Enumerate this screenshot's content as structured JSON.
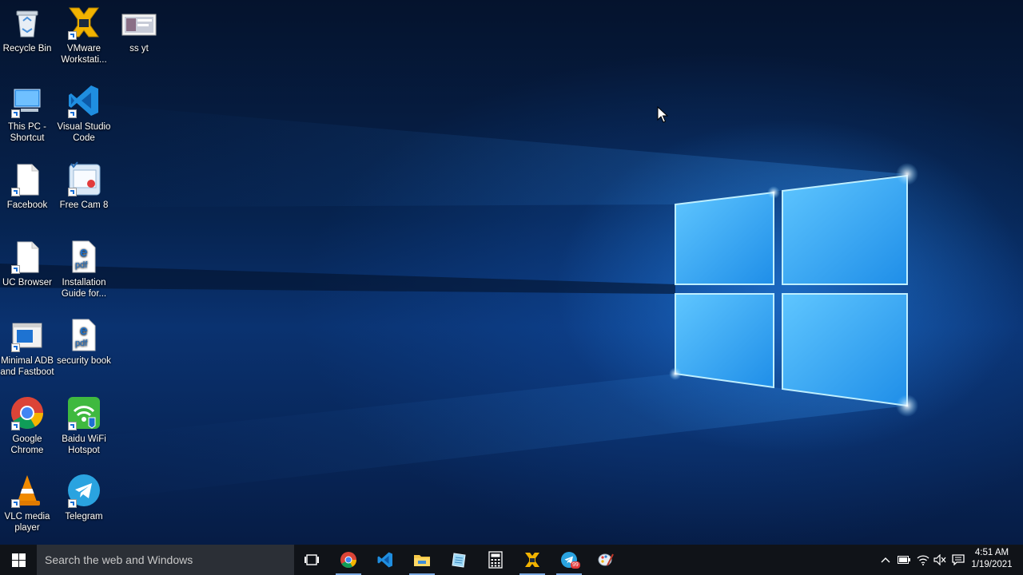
{
  "desktop": {
    "icons": [
      {
        "label": "Recycle Bin",
        "icon": "recycle-bin-icon"
      },
      {
        "label": "VMware Workstati...",
        "icon": "vmware-icon"
      },
      {
        "label": "ss yt",
        "icon": "image-thumbnail-icon"
      },
      {
        "label": "This PC - Shortcut",
        "icon": "this-pc-icon"
      },
      {
        "label": "Visual Studio Code",
        "icon": "vscode-icon"
      },
      {
        "label": "Facebook",
        "icon": "file-icon"
      },
      {
        "label": "Free Cam 8",
        "icon": "free-cam-icon"
      },
      {
        "label": "UC Browser",
        "icon": "file-icon"
      },
      {
        "label": "Installation Guide for...",
        "icon": "edge-pdf-icon"
      },
      {
        "label": "Minimal ADB and Fastboot",
        "icon": "window-app-icon"
      },
      {
        "label": "security book",
        "icon": "edge-pdf-icon"
      },
      {
        "label": "Google Chrome",
        "icon": "chrome-icon"
      },
      {
        "label": "Baidu WiFi Hotspot",
        "icon": "baidu-wifi-icon"
      },
      {
        "label": "VLC media player",
        "icon": "vlc-icon"
      },
      {
        "label": "Telegram",
        "icon": "telegram-icon"
      }
    ]
  },
  "taskbar": {
    "search_placeholder": "Search the web and Windows",
    "pinned": [
      {
        "name": "task-view",
        "icon": "task-view-icon"
      },
      {
        "name": "google-chrome",
        "icon": "chrome-icon"
      },
      {
        "name": "visual-studio-code",
        "icon": "vscode-icon"
      },
      {
        "name": "file-explorer",
        "icon": "folder-icon"
      },
      {
        "name": "notepad",
        "icon": "notepad-icon"
      },
      {
        "name": "calculator",
        "icon": "calculator-icon"
      },
      {
        "name": "vmware",
        "icon": "vmware-icon"
      },
      {
        "name": "telegram",
        "icon": "telegram-icon"
      },
      {
        "name": "paint",
        "icon": "paint-icon"
      }
    ],
    "telegram_badge": "99"
  },
  "tray": {
    "time": "4:51 AM",
    "date": "1/19/2021"
  },
  "colors": {
    "taskbar": "#101318",
    "search_box": "#2b2f36",
    "accent": "#1a6fd6"
  }
}
